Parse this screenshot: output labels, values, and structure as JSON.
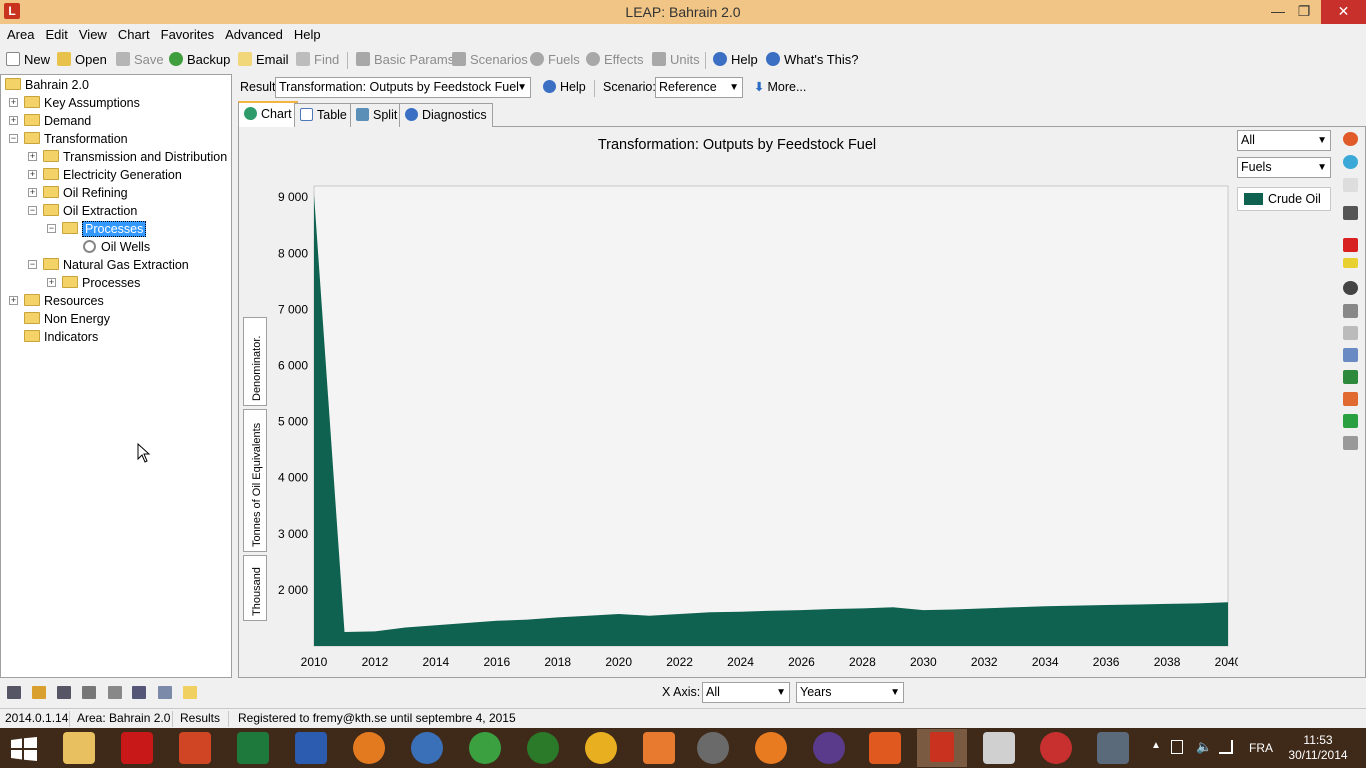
{
  "window": {
    "title": "LEAP: Bahrain 2.0",
    "minimize": "—",
    "restore": "❐",
    "close": "✕"
  },
  "menu": [
    "Area",
    "Edit",
    "View",
    "Chart",
    "Favorites",
    "Advanced",
    "Help"
  ],
  "toolbar": {
    "new": "New",
    "open": "Open",
    "save": "Save",
    "backup": "Backup",
    "email": "Email",
    "find": "Find",
    "basic_params": "Basic Params",
    "scenarios": "Scenarios",
    "fuels": "Fuels",
    "effects": "Effects",
    "units": "Units",
    "help": "Help",
    "whats_this": "What's This?"
  },
  "tree": {
    "root": "Bahrain 2.0",
    "key_assumptions": "Key Assumptions",
    "demand": "Demand",
    "transformation": "Transformation",
    "tnd": "Transmission and Distribution",
    "elec_gen": "Electricity Generation",
    "oil_refining": "Oil Refining",
    "oil_extraction": "Oil Extraction",
    "processes_sel": "Processes",
    "oil_wells": "Oil Wells",
    "ng_extraction": "Natural Gas Extraction",
    "processes": "Processes",
    "resources": "Resources",
    "non_energy": "Non Energy",
    "indicators": "Indicators"
  },
  "result_bar": {
    "result_label": "Result:",
    "result_value": "Transformation: Outputs by Feedstock Fuel",
    "help": "Help",
    "scenario_label": "Scenario:",
    "scenario_value": "Reference",
    "more": "More..."
  },
  "tabs": {
    "chart": "Chart",
    "table": "Table",
    "split": "Split",
    "diagnostics": "Diagnostics"
  },
  "side_buttons": {
    "denominator": "Denominator.",
    "units": "Tonnes of Oil Equivalents",
    "scale": "Thousand"
  },
  "legend_controls": {
    "filter": "All",
    "group": "Fuels"
  },
  "xaxis_bar": {
    "label": "X Axis:",
    "filter": "All",
    "unit": "Years"
  },
  "status": {
    "version": "2014.0.1.14",
    "area": "Area: Bahrain 2.0",
    "view": "Results",
    "registration": "Registered to fremy@kth.se until septembre 4, 2015"
  },
  "taskbar": {
    "lang": "FRA",
    "time": "11:53",
    "date": "30/11/2014"
  },
  "colors": {
    "series": "#0f6250",
    "titlebar": "#f0c585",
    "selection": "#3399ff"
  },
  "chart_data": {
    "type": "area",
    "title": "Transformation: Outputs by Feedstock Fuel",
    "ylabel": "Tonnes of Oil Equivalents",
    "ylim": [
      1000,
      9200
    ],
    "xlim": [
      2010,
      2040
    ],
    "x_ticks": [
      2010,
      2012,
      2014,
      2016,
      2018,
      2020,
      2022,
      2024,
      2026,
      2028,
      2030,
      2032,
      2034,
      2036,
      2038,
      2040
    ],
    "y_ticks": [
      2000,
      3000,
      4000,
      5000,
      6000,
      7000,
      8000,
      9000
    ],
    "y_tick_labels": [
      "2 000",
      "3 000",
      "4 000",
      "5 000",
      "6 000",
      "7 000",
      "8 000",
      "9 000"
    ],
    "legend": "right",
    "series": [
      {
        "name": "Crude Oil",
        "x": [
          2010,
          2011,
          2012,
          2013,
          2014,
          2015,
          2016,
          2017,
          2018,
          2019,
          2020,
          2021,
          2022,
          2023,
          2024,
          2025,
          2026,
          2027,
          2028,
          2029,
          2030,
          2031,
          2032,
          2033,
          2034,
          2035,
          2036,
          2037,
          2038,
          2039,
          2040
        ],
        "values": [
          9050,
          1250,
          1260,
          1330,
          1370,
          1410,
          1450,
          1470,
          1510,
          1540,
          1570,
          1540,
          1570,
          1600,
          1610,
          1630,
          1640,
          1660,
          1670,
          1690,
          1640,
          1650,
          1670,
          1690,
          1710,
          1720,
          1730,
          1740,
          1750,
          1760,
          1780
        ]
      }
    ]
  }
}
